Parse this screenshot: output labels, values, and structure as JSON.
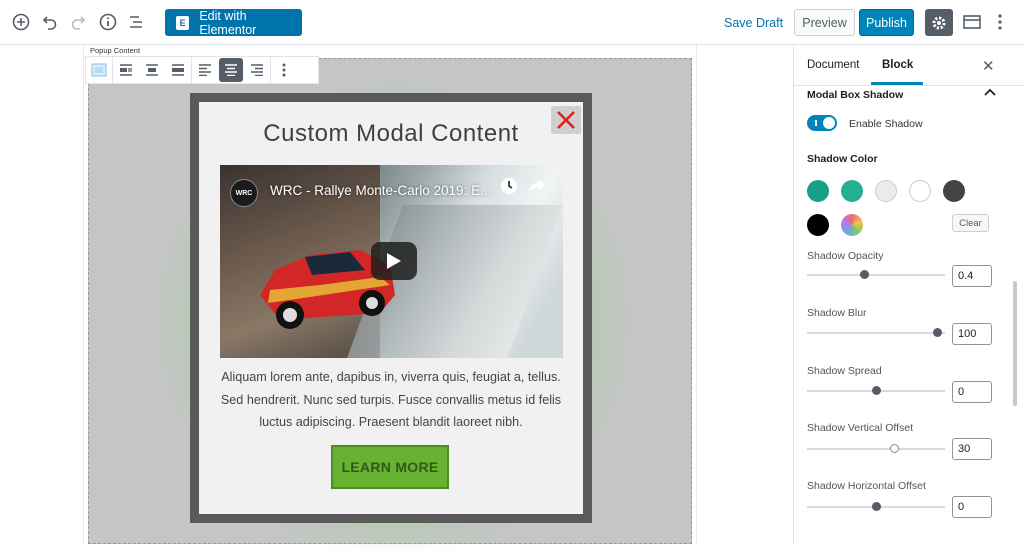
{
  "topbar": {
    "elementor_label": "Edit with Elementor",
    "save_draft": "Save Draft",
    "preview": "Preview",
    "publish": "Publish"
  },
  "editor": {
    "block_label": "Popup Content",
    "modal": {
      "title": "Custom Modal Content",
      "video_title": "WRC - Rallye Monte-Carlo 2019: E...",
      "body_text": "Aliquam lorem ante, dapibus in, viverra quis, feugiat a, tellus. Sed hendrerit. Nunc sed turpis. Fusce convallis metus id felis luctus adipiscing. Praesent blandit laoreet nibh.",
      "button_label": "LEARN MORE"
    }
  },
  "sidebar": {
    "tabs": [
      {
        "label": "Document"
      },
      {
        "label": "Block"
      }
    ],
    "section_title": "Modal Box Shadow",
    "toggle_label": "Enable Shadow",
    "shadow_color_label": "Shadow Color",
    "swatches": [
      "#18a085",
      "#22b091",
      "#ebebeb",
      "#ffffff",
      "#444444",
      "#000000",
      "gradient"
    ],
    "clear_label": "Clear",
    "ranges": [
      {
        "label": "Shadow Opacity",
        "value": "0.4"
      },
      {
        "label": "Shadow Blur",
        "value": "100"
      },
      {
        "label": "Shadow Spread",
        "value": "0"
      },
      {
        "label": "Shadow Vertical Offset",
        "value": "30"
      },
      {
        "label": "Shadow Horizontal Offset",
        "value": "0"
      }
    ]
  },
  "colors": {
    "accent": "#0085ba",
    "button_green": "#67b233",
    "close_red": "#e02020"
  }
}
